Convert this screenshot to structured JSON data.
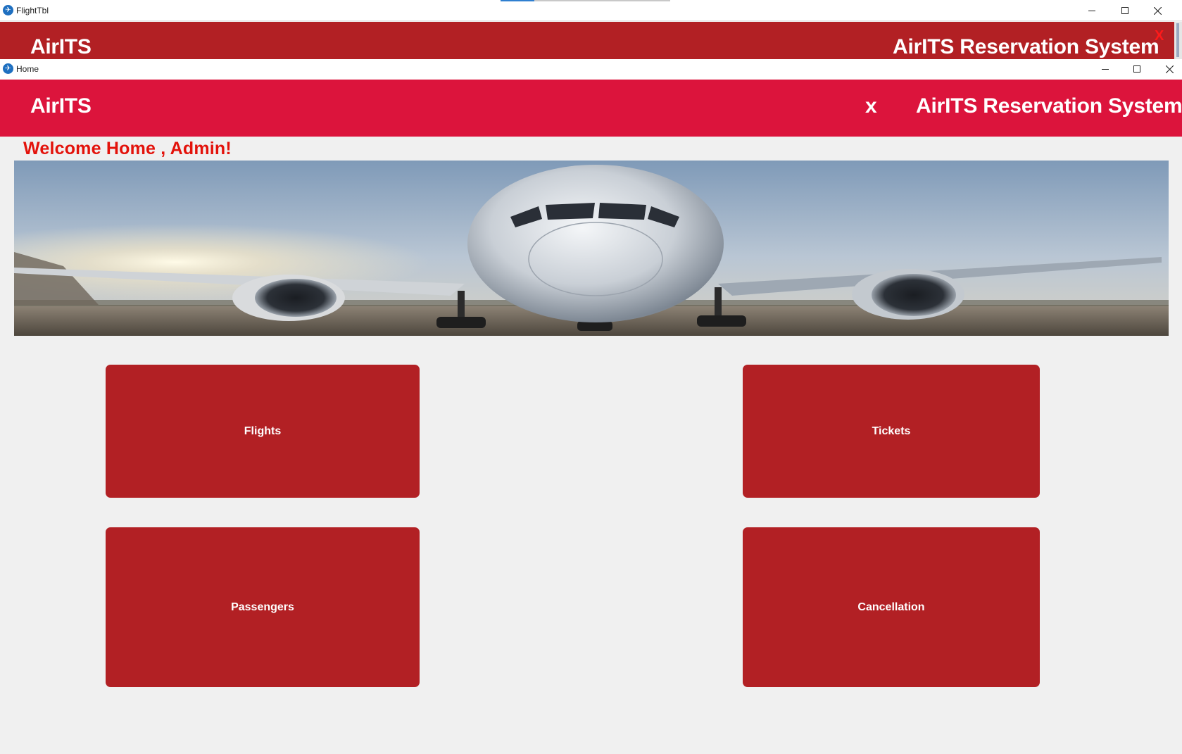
{
  "back_window": {
    "title": "FlightTbl",
    "brand": "AirITS",
    "system_title": "AirITS Reservation System",
    "close_label": "X"
  },
  "front_window": {
    "title": "Home",
    "brand": "AirITS",
    "close_label": "x",
    "system_title": "AirITS Reservation System"
  },
  "welcome_text": "Welcome Home , Admin!",
  "menu": {
    "flights": "Flights",
    "tickets": "Tickets",
    "passengers": "Passengers",
    "cancellation": "Cancellation"
  },
  "icons": {
    "app": "airplane-app-icon",
    "minimize": "minimize-icon",
    "maximize": "maximize-icon",
    "close": "close-icon"
  },
  "colors": {
    "back_header": "#b22024",
    "front_header": "#dc143c",
    "welcome_text": "#e3120b",
    "tile": "#b22024",
    "background": "#f0f0f0"
  }
}
